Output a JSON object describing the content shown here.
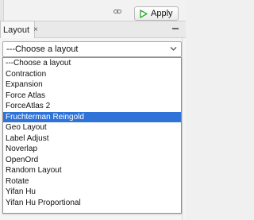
{
  "toolbar": {
    "apply_label": "Apply",
    "link_icon": "link-icon",
    "play_icon": "play-icon"
  },
  "tab": {
    "label": "Layout",
    "close_glyph": "×"
  },
  "combo": {
    "value": "---Choose a layout"
  },
  "dropdown": {
    "options": [
      "---Choose a layout",
      "Contraction",
      "Expansion",
      "Force Atlas",
      "ForceAtlas 2",
      "Fruchterman Reingold",
      "Geo Layout",
      "Label Adjust",
      "Noverlap",
      "OpenOrd",
      "Random Layout",
      "Rotate",
      "Yifan Hu",
      "Yifan Hu Proportional"
    ],
    "selected_index": 5
  },
  "colors": {
    "selection": "#2f73d9",
    "play_green": "#2aa52a"
  }
}
